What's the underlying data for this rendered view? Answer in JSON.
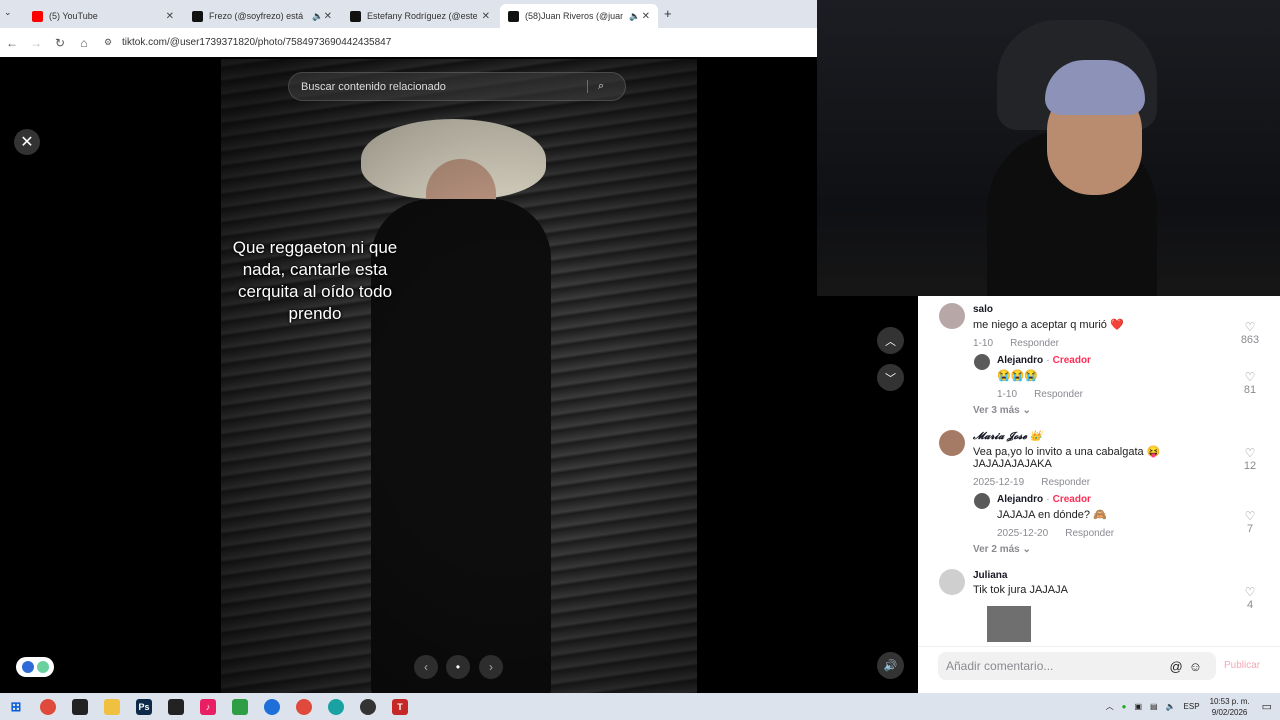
{
  "browser": {
    "tabs": [
      {
        "title": "(5) YouTube",
        "favicon_color": "#ff0000",
        "audio": false,
        "active": false
      },
      {
        "title": "Frezo (@soyfrezo) está emi",
        "favicon_color": "#111111",
        "audio": true,
        "active": false
      },
      {
        "title": "Estefany Rodríguez (@estefany",
        "favicon_color": "#111111",
        "audio": false,
        "active": false
      },
      {
        "title": "(58)Juan Riveros (@juan_ri",
        "favicon_color": "#111111",
        "audio": true,
        "active": true
      }
    ],
    "new_tab": "+",
    "url": "tiktok.com/@user1739371820/photo/7584973690442435847"
  },
  "viewer": {
    "search_placeholder": "Buscar contenido relacionado",
    "caption": "Que reggaeton ni que nada, cantarle esta cerquita al oído todo prendo",
    "close": "✕",
    "prev": "‹",
    "next": "›",
    "dot": "•",
    "up": "︿",
    "down": "﹀",
    "volume": "🔊"
  },
  "comments": [
    {
      "user": "salo",
      "text": "me niego a aceptar q murió ❤️",
      "date": "1-10",
      "reply": "Responder",
      "likes": "863"
    },
    {
      "user": "Alejandro",
      "creator_sep": "·",
      "creator": "Creador",
      "text": "😭😭😭",
      "date": "1-10",
      "reply": "Responder",
      "likes": "81"
    },
    {
      "more": "Ver 3 más"
    },
    {
      "user": "𝓜𝓪𝓻𝓲𝓪 𝓙𝓸𝓼𝓮 👑",
      "text": "Vea pa,yo lo invito a una cabalgata 😝",
      "text2": "JAJAJAJAJAKA",
      "date": "2025-12-19",
      "reply": "Responder",
      "likes": "12"
    },
    {
      "user": "Alejandro",
      "creator_sep": "·",
      "creator": "Creador",
      "text": "JAJAJA en dónde? 🙈",
      "date": "2025-12-20",
      "reply": "Responder",
      "likes": "7"
    },
    {
      "more": "Ver 2 más"
    },
    {
      "user": "Juliana",
      "text": "Tik tok jura JAJAJA",
      "likes": "4"
    }
  ],
  "comment_input": {
    "placeholder": "Añadir comentario...",
    "icons": "@☺",
    "publish": "Publicar"
  },
  "taskbar": {
    "lang": "ESP",
    "time": "10:53 p. m.",
    "date": "9/02/2026"
  }
}
